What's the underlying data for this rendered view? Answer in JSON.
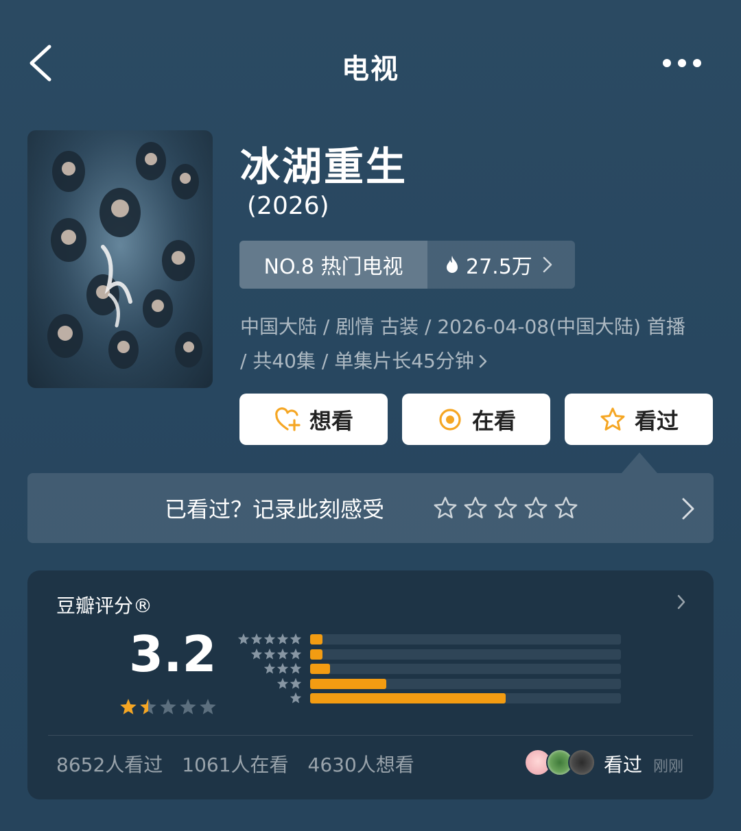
{
  "header": {
    "title": "电视"
  },
  "show": {
    "title": "冰湖重生",
    "year": "(2026)",
    "rank_label": "NO.8 热门电视",
    "heat": "27.5万",
    "meta_line": "中国大陆 / 剧情 古装 / 2026-04-08(中国大陆) 首播 / 共40集 / 单集片长45分钟"
  },
  "actions": {
    "want_label": "想看",
    "watching_label": "在看",
    "watched_label": "看过"
  },
  "prompt": {
    "text": "已看过？记录此刻感受"
  },
  "rating": {
    "label": "豆瓣评分®",
    "score": "3.2",
    "stars_value": 1.5,
    "distribution": [
      {
        "stars": 5,
        "fraction": 0.04
      },
      {
        "stars": 4,
        "fraction": 0.04
      },
      {
        "stars": 3,
        "fraction": 0.065
      },
      {
        "stars": 2,
        "fraction": 0.245
      },
      {
        "stars": 1,
        "fraction": 0.63
      }
    ],
    "stats": {
      "watched": "8652人看过",
      "watching": "1061人在看",
      "want": "4630人想看"
    },
    "recent_label": "看过",
    "recent_time": "刚刚"
  },
  "colors": {
    "accent_orange": "#f5a623",
    "bar_orange": "#f39c12",
    "background": "#284760"
  }
}
